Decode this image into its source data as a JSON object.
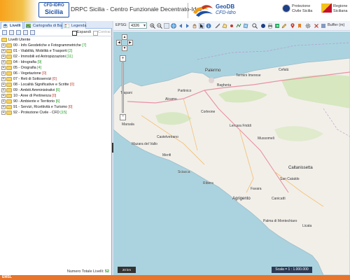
{
  "header": {
    "logo_line1": "CFD-IDRO",
    "logo_line2": "Sicilia",
    "title": "DRPC Sicilia - Centro Funzionale Decentrato-Idro",
    "geodb_name": "GeoDB",
    "geodb_sub": "CFD-Idro",
    "protezione_label": "Protezione Civile Sicilia",
    "regione_label": "Regione Siciliana"
  },
  "left_panel": {
    "tabs": [
      {
        "label": "Livelli",
        "active": true
      },
      {
        "label": "Cartografia di Base",
        "active": false
      },
      {
        "label": "Legenda",
        "active": false
      }
    ],
    "expand_label": "Espandi",
    "collapse_label": "Contrai",
    "root_label": "Livelli Utente",
    "items": [
      {
        "label": "00 - Info Geodetiche e Fotogrammetriche",
        "count": "[7]"
      },
      {
        "label": "01 - Viabilità, Mobilità e Trasporti",
        "count": "[2]"
      },
      {
        "label": "02 - Immobili ed Antropizzazioni",
        "count": "[11]"
      },
      {
        "label": "04 - Idrografia",
        "count": "[9]"
      },
      {
        "label": "05 - Orografia",
        "count": "[4]"
      },
      {
        "label": "06 - Vegetazione",
        "count": "[0]"
      },
      {
        "label": "07 - Reti di Sottoservizi",
        "count": "[0]"
      },
      {
        "label": "08 - Località Significative e Scritte",
        "count": "[0]"
      },
      {
        "label": "09 - Ambiti Amministrativi",
        "count": "[6]"
      },
      {
        "label": "10 - Aree di Pertinenza",
        "count": "[0]"
      },
      {
        "label": "90 - Ambiente e Territorio",
        "count": "[6]"
      },
      {
        "label": "91 - Servizi, Ricettività e Turismo",
        "count": "[0]"
      },
      {
        "label": "92 - Protezione Civile - CFD",
        "count": "[15]"
      }
    ],
    "footer_label": "Numero Totale Livelli:",
    "footer_count": "52"
  },
  "map_toolbar": {
    "epsg_label": "EPSG:",
    "epsg_value": "4326",
    "buffer_label": "Buffer (m)"
  },
  "map": {
    "places": [
      {
        "name": "Palermo",
        "big": true
      },
      {
        "name": "Trapani",
        "big": false
      },
      {
        "name": "Marsala",
        "big": false
      },
      {
        "name": "Mazara del Vallo",
        "big": false
      },
      {
        "name": "Castelvetrano",
        "big": false
      },
      {
        "name": "Sciacca",
        "big": false
      },
      {
        "name": "Caltanissetta",
        "big": true
      },
      {
        "name": "Agrigento",
        "big": true
      },
      {
        "name": "Licata",
        "big": false
      },
      {
        "name": "Canicattì",
        "big": false
      },
      {
        "name": "Termini Imerese",
        "big": false
      },
      {
        "name": "Cefalù",
        "big": false
      },
      {
        "name": "Corleone",
        "big": false
      },
      {
        "name": "Partinico",
        "big": false
      },
      {
        "name": "Bagheria",
        "big": false
      },
      {
        "name": "Alcamo",
        "big": false
      },
      {
        "name": "Palma di Montechiaro",
        "big": false
      },
      {
        "name": "Favara",
        "big": false
      },
      {
        "name": "Ribera",
        "big": false
      },
      {
        "name": "Menfi",
        "big": false
      },
      {
        "name": "Lercara Friddi",
        "big": false
      },
      {
        "name": "San Cataldo",
        "big": false
      },
      {
        "name": "Mussomeli",
        "big": false
      }
    ],
    "scale_bar_label": "20 km",
    "scale_text": "Scala = 1 : 1.000.000"
  },
  "footer": {
    "logo_text": "EMSL"
  },
  "colors": {
    "sea": "#aad3df",
    "land": "#f2efe9",
    "accent": "#e7752b",
    "count_green": "#1e9b1e"
  }
}
